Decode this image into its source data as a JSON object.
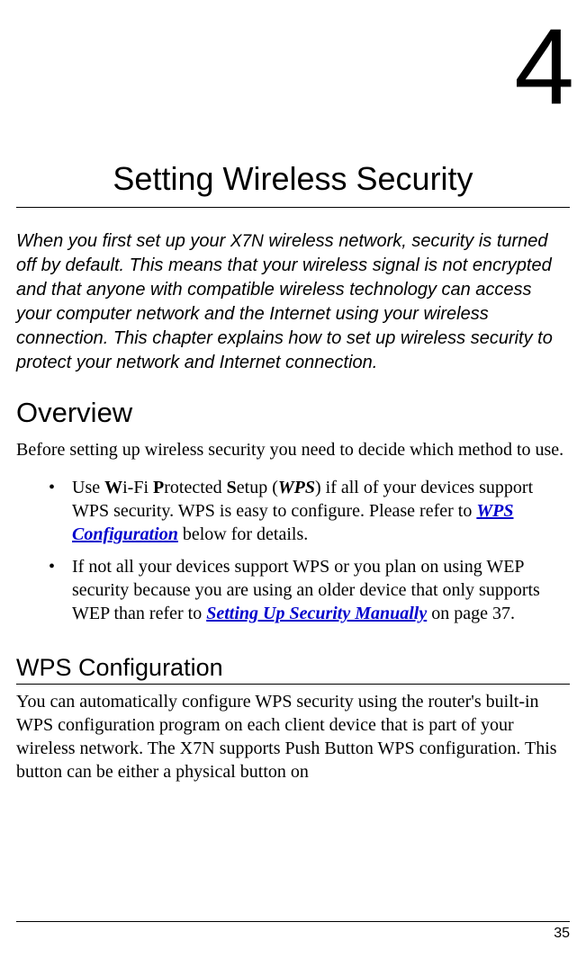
{
  "chapter": {
    "number": "4",
    "title": "Setting Wireless Security"
  },
  "intro": {
    "part1": "When you first set up your ",
    "product": "X7N",
    "part2": " wireless network, security is turned off by default. This means that your wireless signal is not encrypted and that anyone with compatible wireless technology can access your computer network and the Internet using your wireless connection. This chapter explains how to set up wireless security to protect your network and Internet connection."
  },
  "overview": {
    "heading": "Overview",
    "body": "Before setting up wireless security you need to decide which method to use.",
    "bullets": {
      "b1": {
        "t1": "Use ",
        "w": "W",
        "t2": "i-Fi ",
        "p": "P",
        "t3": "rotected ",
        "s": "S",
        "t4": "etup (",
        "wps": "WPS",
        "t5": ") if all of your devices support  WPS security. WPS is easy to configure. Please refer to ",
        "link1": "WPS Configuration",
        "t6": " below for details."
      },
      "b2": {
        "t1": "If not all your devices support WPS or you plan on using WEP security because you are using an older device that only supports WEP than refer to ",
        "link2": "Setting Up Security Manually",
        "t2": " on page 37."
      }
    }
  },
  "wpsconfig": {
    "heading": "WPS Configuration",
    "body": "You can automatically configure WPS security using the router's built-in WPS configuration program on each client device that is part of your wireless network. The X7N supports Push Button WPS configuration. This button can be either a physical button on"
  },
  "footer": {
    "page": "35"
  }
}
